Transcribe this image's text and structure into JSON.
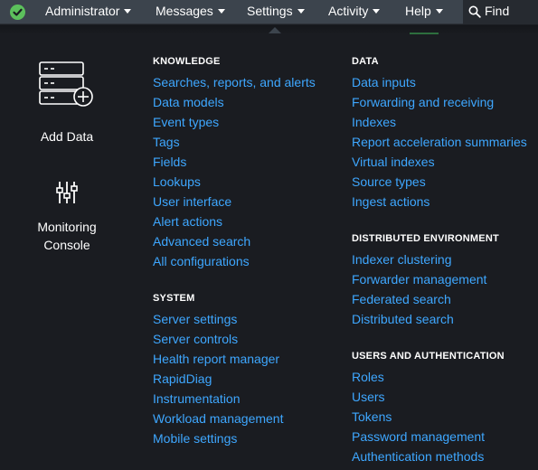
{
  "nav": {
    "items": [
      {
        "label": "Administrator"
      },
      {
        "label": "Messages"
      },
      {
        "label": "Settings"
      },
      {
        "label": "Activity"
      },
      {
        "label": "Help"
      }
    ],
    "find_placeholder": "Find"
  },
  "tiles": {
    "add_data": "Add Data",
    "monitoring_line1": "Monitoring",
    "monitoring_line2": "Console"
  },
  "knowledge": {
    "heading": "KNOWLEDGE",
    "links": [
      "Searches, reports, and alerts",
      "Data models",
      "Event types",
      "Tags",
      "Fields",
      "Lookups",
      "User interface",
      "Alert actions",
      "Advanced search",
      "All configurations"
    ]
  },
  "system": {
    "heading": "SYSTEM",
    "links": [
      "Server settings",
      "Server controls",
      "Health report manager",
      "RapidDiag",
      "Instrumentation",
      "Workload management",
      "Mobile settings"
    ]
  },
  "data_section": {
    "heading": "DATA",
    "links": [
      "Data inputs",
      "Forwarding and receiving",
      "Indexes",
      "Report acceleration summaries",
      "Virtual indexes",
      "Source types",
      "Ingest actions"
    ]
  },
  "distributed": {
    "heading": "DISTRIBUTED ENVIRONMENT",
    "links": [
      "Indexer clustering",
      "Forwarder management",
      "Federated search",
      "Distributed search"
    ]
  },
  "users_auth": {
    "heading": "USERS AND AUTHENTICATION",
    "links": [
      "Roles",
      "Users",
      "Tokens",
      "Password management",
      "Authentication methods"
    ]
  },
  "colors": {
    "background": "#1a1c21",
    "topbar": "#3c444d",
    "link": "#3ea7ff",
    "status_ok": "#5cc05c"
  }
}
